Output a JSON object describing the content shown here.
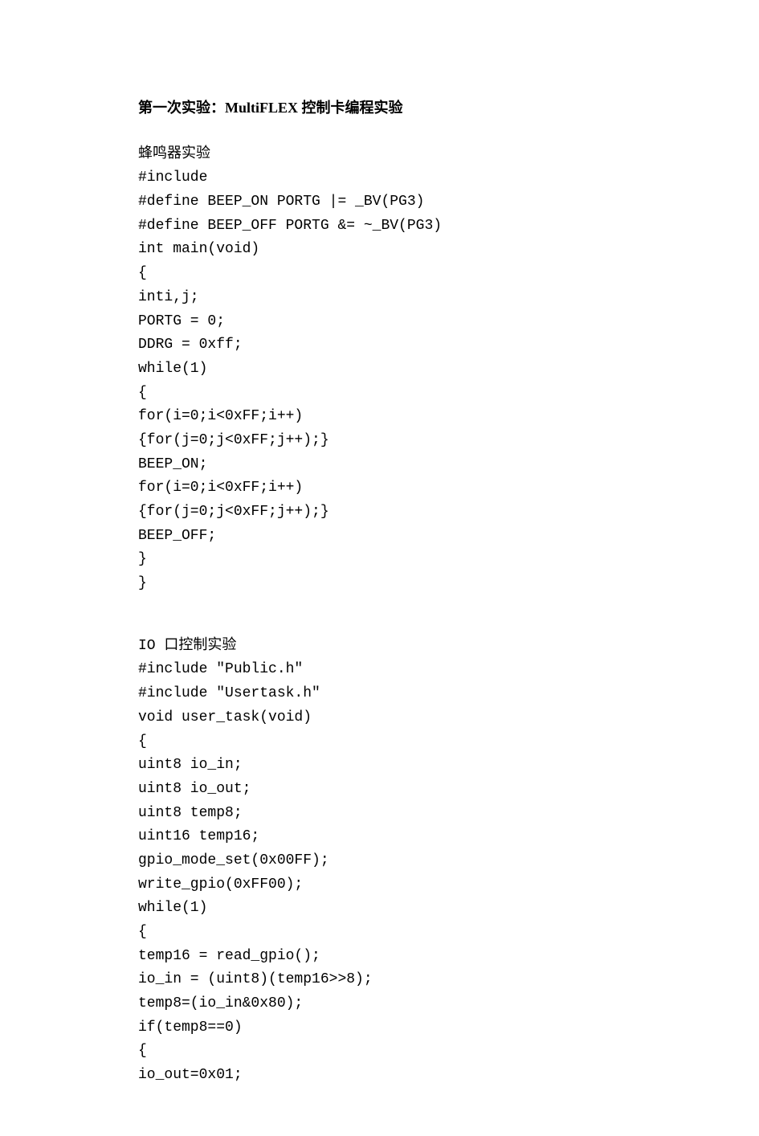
{
  "dot_top": "·",
  "title": "第一次实验：MultiFLEX  控制卡编程实验",
  "sub1": "蜂鸣器实验",
  "code1": [
    "#include",
    "#define BEEP_ON PORTG |= _BV(PG3)",
    "#define BEEP_OFF PORTG &= ~_BV(PG3)",
    "int main(void)",
    "{",
    "inti,j;",
    "PORTG = 0;",
    "DDRG = 0xff;",
    "while(1)",
    "{",
    "for(i=0;i<0xFF;i++)",
    "{for(j=0;j<0xFF;j++);}",
    "BEEP_ON;",
    "for(i=0;i<0xFF;i++)",
    "{for(j=0;j<0xFF;j++);}",
    "BEEP_OFF;",
    "}",
    "}"
  ],
  "sub2": "IO 口控制实验",
  "code2": [
    "#include \"Public.h\"",
    "#include \"Usertask.h\"",
    "void user_task(void)",
    "{",
    "uint8 io_in;",
    "uint8 io_out;",
    "uint8 temp8;",
    "uint16 temp16;",
    "gpio_mode_set(0x00FF);",
    "write_gpio(0xFF00);",
    "while(1)",
    "{",
    "temp16 = read_gpio();",
    "io_in = (uint8)(temp16>>8);",
    "temp8=(io_in&0x80);",
    "if(temp8==0)",
    "{",
    "io_out=0x01;"
  ],
  "dot_bottom": "·"
}
